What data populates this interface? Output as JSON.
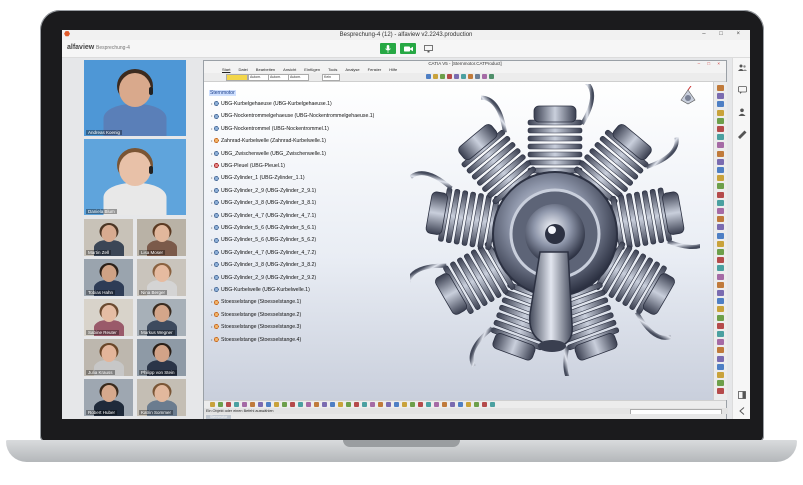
{
  "window": {
    "title": "Besprechung-4 (12) - alfaview v2.2243.production",
    "controls": "–  □  ×"
  },
  "app": {
    "brand": "alfaview",
    "meeting_name": "Besprechung-4",
    "mic_icon": "microphone-icon",
    "camera_icon": "camera-icon",
    "screen_icon": "screen-share-icon",
    "accent": "#27a844"
  },
  "participants": [
    {
      "name": "Andreas Koenig",
      "skin": "#d9a98c",
      "bg": "#4e97d6",
      "shirt": "#5a7fb8",
      "hair": "#3c2a1e"
    },
    {
      "name": "Daniela Blum",
      "skin": "#e8c1a8",
      "bg": "#5fa4dc",
      "shirt": "#e8e8e8",
      "hair": "#7a5534"
    },
    {
      "name": "Martin Zell",
      "skin": "#d8ab90",
      "bg": "#c8c2b8",
      "shirt": "#3b4656",
      "hair": "#4a3524"
    },
    {
      "name": "Lisa Moser",
      "skin": "#e1b79c",
      "bg": "#b9b2a6",
      "shirt": "#7b5a4a",
      "hair": "#5b3a22"
    },
    {
      "name": "Tobias Hahn",
      "skin": "#cfa285",
      "bg": "#9aa4ae",
      "shirt": "#2e3c56",
      "hair": "#2b2018"
    },
    {
      "name": "Nina Berger",
      "skin": "#e6bba0",
      "bg": "#c9c4bc",
      "shirt": "#d4d4d4",
      "hair": "#8a6240"
    },
    {
      "name": "Sabine Reuter",
      "skin": "#e5bda4",
      "bg": "#d8d3ca",
      "shirt": "#9a5a6a",
      "hair": "#6b4a30"
    },
    {
      "name": "Markus Wegner",
      "skin": "#d4a68a",
      "bg": "#a7b0b8",
      "shirt": "#3d4a5e",
      "hair": "#3a2c20"
    },
    {
      "name": "Julia Krauss",
      "skin": "#e3b59a",
      "bg": "#bdb7ae",
      "shirt": "#c7c7c7",
      "hair": "#6a4628"
    },
    {
      "name": "Philipp von Stein",
      "skin": "#d2a388",
      "bg": "#8e9aa6",
      "shirt": "#2b3548",
      "hair": "#2a1f17"
    },
    {
      "name": "Robert Huber",
      "skin": "#d6a98d",
      "bg": "#9ea7b1",
      "shirt": "#1f2a3a",
      "hair": "#3a2a1c"
    },
    {
      "name": "Katrin Sommer",
      "skin": "#e2b89d",
      "bg": "#c4beb4",
      "shirt": "#6b7c8f",
      "hair": "#7a5636"
    }
  ],
  "catia": {
    "title": "CATIA V5 - [Sternmotor.CATProduct]",
    "menu": [
      "Start",
      "Datei",
      "Bearbeiten",
      "Ansicht",
      "Einfügen",
      "Tools",
      "Analyse",
      "Fenster",
      "Hilfe"
    ],
    "toolbar_fields": [
      "",
      "Autom.",
      "Autom.",
      "Autom.",
      "Kein"
    ],
    "status": "Ein Objekt oder einen Befehl auswählen",
    "taskbar_item": "Sternmotor",
    "tree_root": "Sternmotor",
    "tree": [
      {
        "label": "UBG-Kurbelgehaeuse (UBG-Kurbelgehaeuse.1)",
        "icon": "product-icon"
      },
      {
        "label": "UBG-Nockentrommelgehaeuse (UBG-Nockentrommelgehaeuse.1)",
        "icon": "product-icon"
      },
      {
        "label": "UBG-Nockentrommel (UBG-Nockentrommel.1)",
        "icon": "product-icon"
      },
      {
        "label": "Zahnrad-Kurbelwelle (Zahnrad-Kurbelwelle.1)",
        "icon": "part-icon"
      },
      {
        "label": "UBG_Zwischenwelle (UBG_Zwischenwelle.1)",
        "icon": "product-icon"
      },
      {
        "label": "UBG-Pleuel (UBG-Pleuel.1)",
        "icon": "part-red-icon"
      },
      {
        "label": "UBG-Zylinder_1 (UBG-Zylinder_1.1)",
        "icon": "product-icon"
      },
      {
        "label": "UBG-Zylinder_2_9 (UBG-Zylinder_2_9.1)",
        "icon": "product-icon"
      },
      {
        "label": "UBG-Zylinder_3_8 (UBG-Zylinder_3_8.1)",
        "icon": "product-icon"
      },
      {
        "label": "UBG-Zylinder_4_7 (UBG-Zylinder_4_7.1)",
        "icon": "product-icon"
      },
      {
        "label": "UBG-Zylinder_5_6 (UBG-Zylinder_5_6.1)",
        "icon": "product-icon"
      },
      {
        "label": "UBG-Zylinder_5_6 (UBG-Zylinder_5_6.2)",
        "icon": "product-icon"
      },
      {
        "label": "UBG-Zylinder_4_7 (UBG-Zylinder_4_7.2)",
        "icon": "product-icon"
      },
      {
        "label": "UBG-Zylinder_3_8 (UBG-Zylinder_3_8.2)",
        "icon": "product-icon"
      },
      {
        "label": "UBG-Zylinder_2_9 (UBG-Zylinder_2_9.2)",
        "icon": "product-icon"
      },
      {
        "label": "UBG-Kurbelwelle (UBG-Kurbelwelle.1)",
        "icon": "product-icon"
      },
      {
        "label": "Stoesselstange (Stoesselstange.1)",
        "icon": "part-icon"
      },
      {
        "label": "Stoesselstange (Stoesselstange.2)",
        "icon": "part-icon"
      },
      {
        "label": "Stoesselstange (Stoesselstange.3)",
        "icon": "part-icon"
      },
      {
        "label": "Stoesselstange (Stoesselstange.4)",
        "icon": "part-icon"
      }
    ]
  },
  "rail_icons": [
    "participants-icon",
    "chat-icon",
    "user-icon",
    "settings-icon",
    "layout-icon",
    "collapse-icon"
  ]
}
